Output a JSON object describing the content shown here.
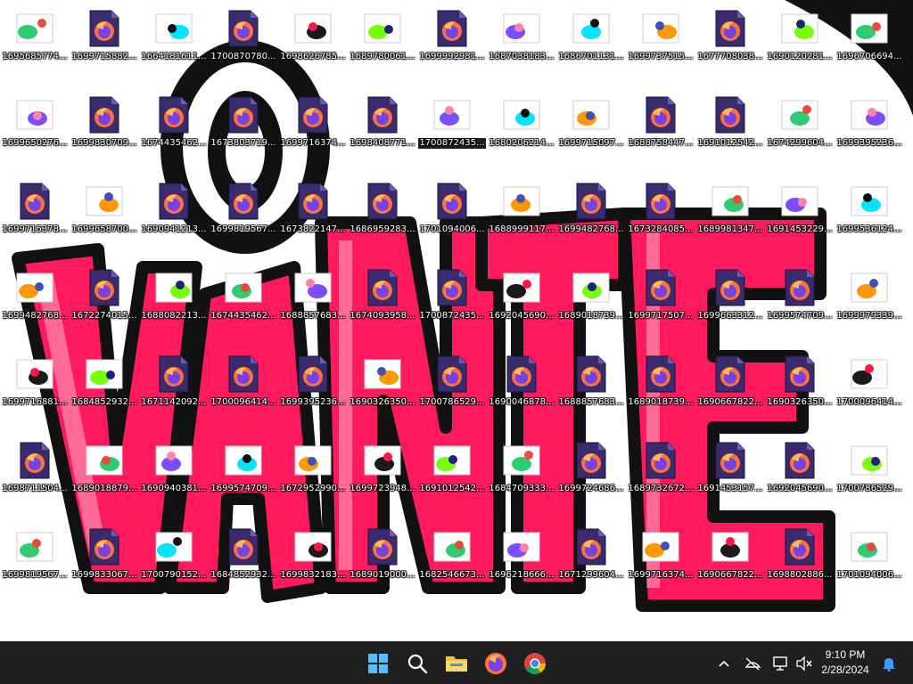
{
  "desktop": {
    "icons": [
      {
        "label": "1695685774...",
        "kind": "paint"
      },
      {
        "label": "1699715882...",
        "kind": "firefox"
      },
      {
        "label": "1664181611...",
        "kind": "paint"
      },
      {
        "label": "1700870780...",
        "kind": "firefox"
      },
      {
        "label": "1698626785...",
        "kind": "paint"
      },
      {
        "label": "1689780061...",
        "kind": "paint"
      },
      {
        "label": "1699992981...",
        "kind": "firefox"
      },
      {
        "label": "1687038183...",
        "kind": "paint"
      },
      {
        "label": "1686701131...",
        "kind": "paint"
      },
      {
        "label": "1699737515...",
        "kind": "paint"
      },
      {
        "label": "1677708038...",
        "kind": "firefox"
      },
      {
        "label": "1690120281...",
        "kind": "paint"
      },
      {
        "label": "1696706694...",
        "kind": "paint"
      },
      {
        "label": "1699650276...",
        "kind": "paint"
      },
      {
        "label": "1699830709...",
        "kind": "firefox"
      },
      {
        "label": "1674435462...",
        "kind": "firefox"
      },
      {
        "label": "1673803719...",
        "kind": "firefox"
      },
      {
        "label": "1699716374...",
        "kind": "firefox"
      },
      {
        "label": "1698408771...",
        "kind": "firefox"
      },
      {
        "label": "1700872435...",
        "kind": "paint",
        "selected": true
      },
      {
        "label": "1680206214...",
        "kind": "paint"
      },
      {
        "label": "1699715097...",
        "kind": "paint"
      },
      {
        "label": "1688758447...",
        "kind": "firefox"
      },
      {
        "label": "1691012542...",
        "kind": "firefox"
      },
      {
        "label": "1674299604...",
        "kind": "paint"
      },
      {
        "label": "1699395236...",
        "kind": "paint"
      },
      {
        "label": "1699715378...",
        "kind": "firefox"
      },
      {
        "label": "1699658700...",
        "kind": "paint"
      },
      {
        "label": "1690941213...",
        "kind": "firefox"
      },
      {
        "label": "1699819567...",
        "kind": "firefox"
      },
      {
        "label": "1673822147...",
        "kind": "firefox"
      },
      {
        "label": "1686959283...",
        "kind": "firefox"
      },
      {
        "label": "1701094006...",
        "kind": "firefox"
      },
      {
        "label": "1688999117...",
        "kind": "paint"
      },
      {
        "label": "1699482768...",
        "kind": "firefox"
      },
      {
        "label": "1673284085...",
        "kind": "firefox"
      },
      {
        "label": "1689981347...",
        "kind": "paint"
      },
      {
        "label": "1691453229...",
        "kind": "paint"
      },
      {
        "label": "1699536124...",
        "kind": "paint"
      },
      {
        "label": "1699482768...",
        "kind": "paint"
      },
      {
        "label": "1672274015...",
        "kind": "firefox"
      },
      {
        "label": "1688082213...",
        "kind": "paint"
      },
      {
        "label": "1674435462...",
        "kind": "paint"
      },
      {
        "label": "1688857683...",
        "kind": "paint"
      },
      {
        "label": "1674093958...",
        "kind": "firefox"
      },
      {
        "label": "1700872435...",
        "kind": "firefox"
      },
      {
        "label": "1692045690...",
        "kind": "paint"
      },
      {
        "label": "1689018739...",
        "kind": "paint"
      },
      {
        "label": "1699717507...",
        "kind": "firefox"
      },
      {
        "label": "1699663312...",
        "kind": "firefox"
      },
      {
        "label": "1699574709...",
        "kind": "firefox"
      },
      {
        "label": "1699979339...",
        "kind": "paint"
      },
      {
        "label": "1699716881...",
        "kind": "paint"
      },
      {
        "label": "1684852932...",
        "kind": "paint"
      },
      {
        "label": "1671142092...",
        "kind": "firefox"
      },
      {
        "label": "1700096414...",
        "kind": "firefox"
      },
      {
        "label": "1699395236...",
        "kind": "firefox"
      },
      {
        "label": "1690326350...",
        "kind": "paint"
      },
      {
        "label": "1700786529...",
        "kind": "firefox"
      },
      {
        "label": "1690046878...",
        "kind": "firefox"
      },
      {
        "label": "1688857683...",
        "kind": "firefox"
      },
      {
        "label": "1689018739...",
        "kind": "firefox"
      },
      {
        "label": "1690667822...",
        "kind": "firefox"
      },
      {
        "label": "1690326350...",
        "kind": "firefox"
      },
      {
        "label": "1700096414...",
        "kind": "paint"
      },
      {
        "label": "1698711504...",
        "kind": "firefox"
      },
      {
        "label": "1689018879...",
        "kind": "paint"
      },
      {
        "label": "1690940381...",
        "kind": "paint"
      },
      {
        "label": "1699574709...",
        "kind": "paint"
      },
      {
        "label": "1672952990...",
        "kind": "paint"
      },
      {
        "label": "1699723948...",
        "kind": "paint"
      },
      {
        "label": "1691012542...",
        "kind": "paint"
      },
      {
        "label": "1684709333...",
        "kind": "paint"
      },
      {
        "label": "1699724686...",
        "kind": "firefox"
      },
      {
        "label": "1689732672...",
        "kind": "firefox"
      },
      {
        "label": "1691453157...",
        "kind": "firefox"
      },
      {
        "label": "1692045690...",
        "kind": "firefox"
      },
      {
        "label": "1700786529...",
        "kind": "paint"
      },
      {
        "label": "1699819567...",
        "kind": "paint"
      },
      {
        "label": "1699833067...",
        "kind": "firefox"
      },
      {
        "label": "1700790152...",
        "kind": "paint"
      },
      {
        "label": "1684852932...",
        "kind": "firefox"
      },
      {
        "label": "1699832183...",
        "kind": "paint"
      },
      {
        "label": "1689019000...",
        "kind": "firefox"
      },
      {
        "label": "1682546673...",
        "kind": "paint"
      },
      {
        "label": "1696218666...",
        "kind": "paint"
      },
      {
        "label": "1671299604...",
        "kind": "firefox"
      },
      {
        "label": "1699716374...",
        "kind": "paint"
      },
      {
        "label": "1690667822...",
        "kind": "paint"
      },
      {
        "label": "1698802886...",
        "kind": "firefox"
      },
      {
        "label": "1701094006...",
        "kind": "paint"
      }
    ]
  },
  "taskbar": {
    "pinned": [
      {
        "name": "start-button",
        "icon": "windows-logo-icon"
      },
      {
        "name": "search-button",
        "icon": "search-icon"
      },
      {
        "name": "file-explorer-button",
        "icon": "folder-icon"
      },
      {
        "name": "firefox-button",
        "icon": "firefox-icon"
      },
      {
        "name": "chrome-button",
        "icon": "chrome-icon"
      }
    ],
    "tray": {
      "chevron_icon": "chevron-up-icon",
      "network_icon": "no-network-icon",
      "display_icon": "display-icon",
      "volume_icon": "volume-muted-icon",
      "notifications_icon": "bell-icon"
    },
    "clock": {
      "time": "9:10 PM",
      "date": "2/28/2024"
    }
  },
  "colors": {
    "accent": "#ff1a5e",
    "taskbar_bg": "#1f1f1f",
    "notification_blue": "#3b9cff"
  }
}
